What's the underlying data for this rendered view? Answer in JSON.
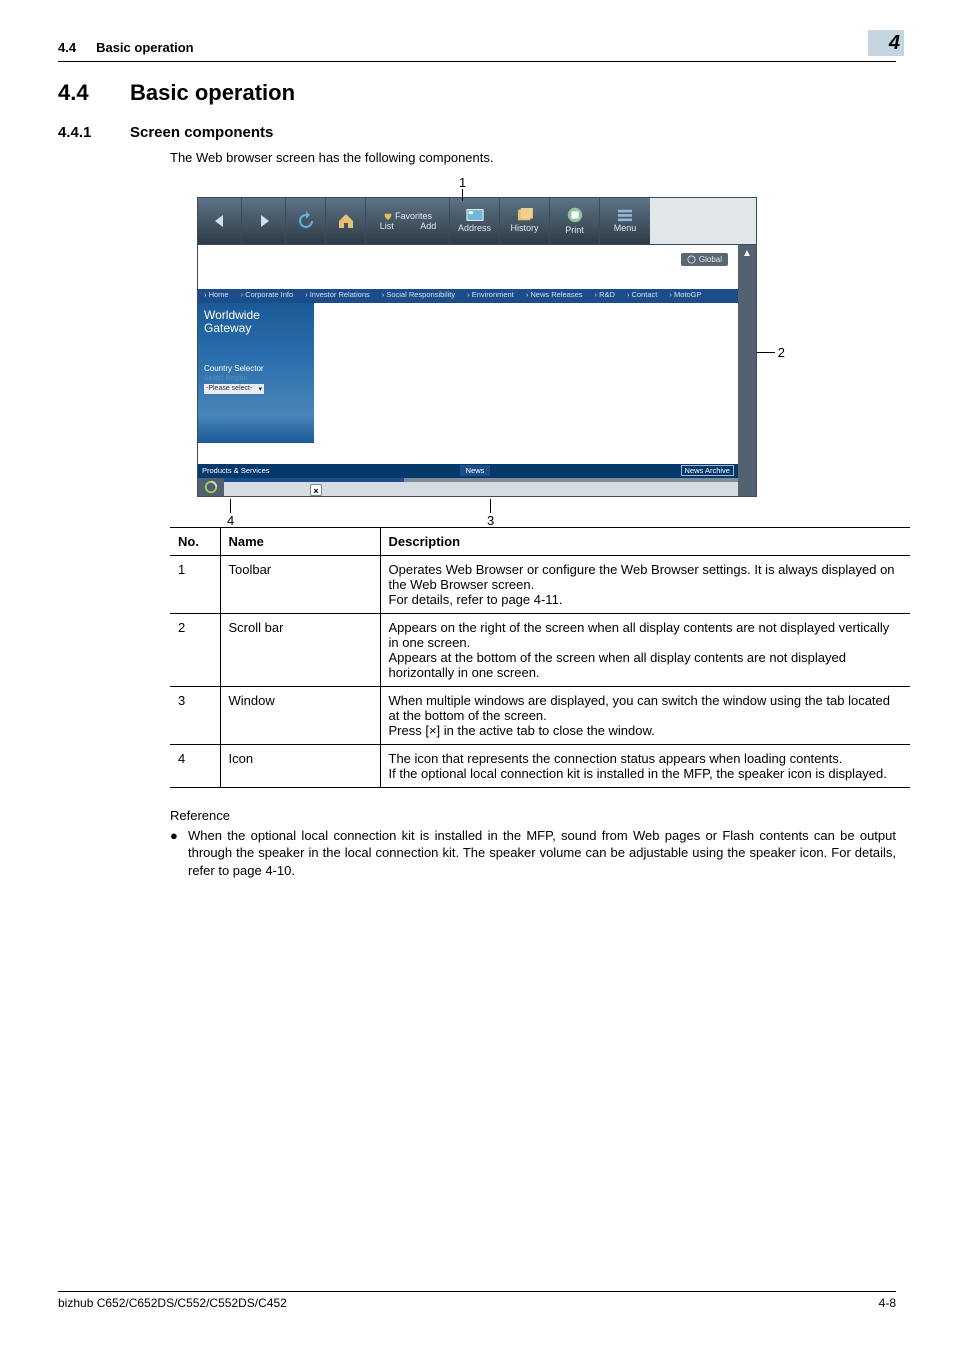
{
  "header": {
    "section_number": "4.4",
    "section_title": "Basic operation",
    "chapter_tab": "4"
  },
  "h1": {
    "number": "4.4",
    "title": "Basic operation"
  },
  "h2": {
    "number": "4.4.1",
    "title": "Screen components"
  },
  "intro": "The Web browser screen has the following components.",
  "figure": {
    "callouts": {
      "c1": "1",
      "c2": "2",
      "c3": "3",
      "c4": "4"
    },
    "toolbar": {
      "favorites": "Favorites",
      "list": "List",
      "add": "Add",
      "address": "Address",
      "history": "History",
      "print": "Print",
      "menu": "Menu"
    },
    "page": {
      "global": "Global",
      "nav": {
        "home": "› Home",
        "corp": "› Corporate Info",
        "inv": "› Investor Relations",
        "soc": "› Social Responsibility",
        "env": "› Environment",
        "news": "› News Releases",
        "rd": "› R&D",
        "contact": "› Contact",
        "moto": "› MotoGP"
      },
      "side": {
        "wwg1": "Worldwide",
        "wwg2": "Gateway",
        "csel": "Country Selector",
        "sreg": "Select Region",
        "dd": "-Please select-"
      },
      "prod": {
        "ps": "Products & Services",
        "news": "News",
        "arch": "News Archive"
      },
      "close_x": "×"
    }
  },
  "table": {
    "head": {
      "no": "No.",
      "name": "Name",
      "desc": "Description"
    },
    "rows": [
      {
        "no": "1",
        "name": "Toolbar",
        "desc": "Operates Web Browser or configure the Web Browser settings. It is always displayed on the Web Browser screen.\nFor details, refer to page 4-11."
      },
      {
        "no": "2",
        "name": "Scroll bar",
        "desc": "Appears on the right of the screen when all display contents are not displayed vertically in one screen.\nAppears at the bottom of the screen when all display contents are not displayed horizontally in one screen."
      },
      {
        "no": "3",
        "name": "Window",
        "desc": "When multiple windows are displayed, you can switch the window using the tab located at the bottom of the screen.\nPress [×] in the active tab to close the window."
      },
      {
        "no": "4",
        "name": "Icon",
        "desc": "The icon that represents the connection status appears when loading contents.\nIf the optional local connection kit is installed in the MFP, the speaker icon is displayed."
      }
    ]
  },
  "reference": {
    "head": "Reference",
    "bullet": "When the optional local connection kit is installed in the MFP, sound from Web pages or Flash contents can be output through the speaker in the local connection kit. The speaker volume can be adjustable using the speaker icon. For details, refer to page 4-10."
  },
  "footer": {
    "left": "bizhub C652/C652DS/C552/C552DS/C452",
    "right": "4-8"
  }
}
